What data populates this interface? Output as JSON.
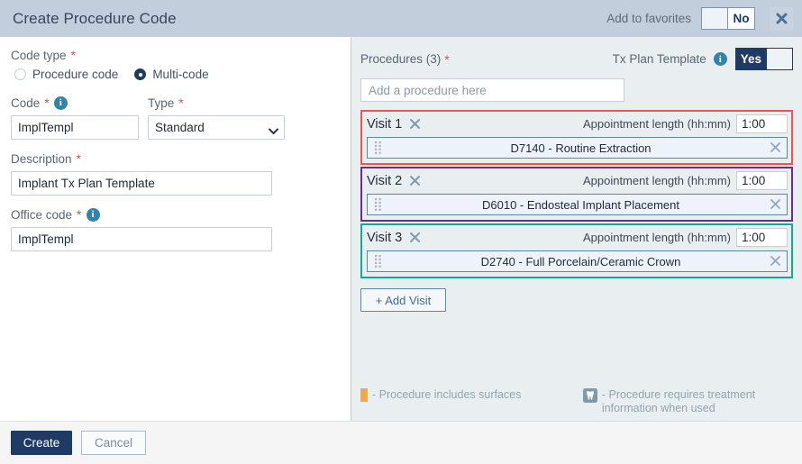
{
  "header": {
    "title": "Create Procedure Code",
    "favorites_label": "Add to favorites",
    "favorites_value": "No",
    "close_icon": "close-icon"
  },
  "left": {
    "code_type": {
      "label": "Code type",
      "required": "*"
    },
    "radios": [
      {
        "label": "Procedure code",
        "selected": false
      },
      {
        "label": "Multi-code",
        "selected": true
      }
    ],
    "code": {
      "label": "Code",
      "required": "*",
      "value": "ImplTempl",
      "info_icon": "info-icon"
    },
    "type": {
      "label": "Type",
      "required": "*",
      "value": "Standard",
      "options": [
        "Standard"
      ]
    },
    "description": {
      "label": "Description",
      "required": "*",
      "value": "Implant Tx Plan Template"
    },
    "office_code": {
      "label": "Office code",
      "required": "*",
      "value": "ImplTempl",
      "info_icon": "info-icon"
    }
  },
  "right": {
    "procedures_label": "Procedures (3)",
    "procedures_required": "*",
    "tx_plan_label": "Tx Plan Template",
    "tx_plan_value": "Yes",
    "tx_plan_info_icon": "info-icon",
    "add_procedure_placeholder": "Add a procedure here",
    "appointment_length_label": "Appointment length (hh:mm)",
    "add_visit_label": "+ Add Visit",
    "visits": [
      {
        "name": "Visit 1",
        "border_color": "#f2534f",
        "appointment_length": "1:00",
        "procedures": [
          {
            "name": "D7140 - Routine Extraction"
          }
        ]
      },
      {
        "name": "Visit 2",
        "border_color": "#6b2d91",
        "appointment_length": "1:00",
        "procedures": [
          {
            "name": "D6010 - Endosteal Implant Placement"
          }
        ]
      },
      {
        "name": "Visit 3",
        "border_color": "#0fab93",
        "appointment_length": "1:00",
        "procedures": [
          {
            "name": "D2740 - Full Porcelain/Ceramic Crown"
          }
        ]
      }
    ],
    "legend": [
      {
        "icon": "orange-square-icon",
        "text": "- Procedure includes surfaces",
        "color": "#eda94a"
      },
      {
        "icon": "tooth-icon",
        "text": "- Procedure requires treatment information when used",
        "color": "#7f99ad"
      }
    ]
  },
  "footer": {
    "create_label": "Create",
    "cancel_label": "Cancel"
  }
}
